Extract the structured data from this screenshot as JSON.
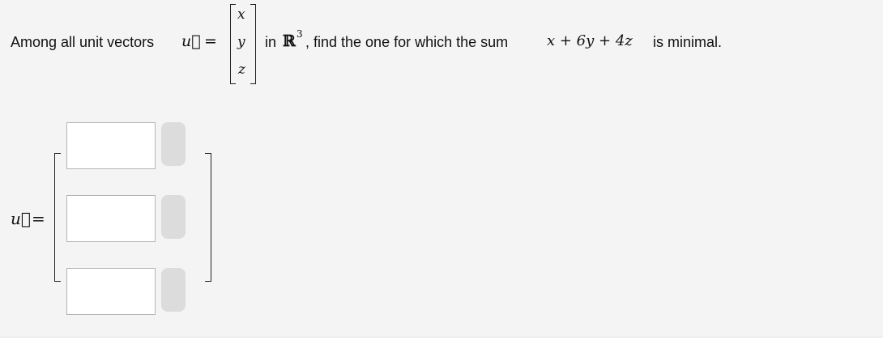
{
  "question": {
    "prefix": "Among all unit vectors",
    "vector_symbol": "u⃗",
    "equals": "=",
    "components": [
      "x",
      "y",
      "z"
    ],
    "in_text": "in",
    "space_symbol": "ℝ",
    "space_exponent": "3",
    "middle_text": ", find the one for which the sum",
    "sum_expression": "x + 6y + 4z",
    "suffix": "is minimal."
  },
  "answer": {
    "vector_symbol": "u⃗",
    "equals": "=",
    "fields": [
      {
        "value": "",
        "placeholder": ""
      },
      {
        "value": "",
        "placeholder": ""
      },
      {
        "value": "",
        "placeholder": ""
      }
    ]
  },
  "colors": {
    "background": "#f4f4f4",
    "input_border": "#b5b5b5",
    "status_pill": "#dcdcdc"
  }
}
